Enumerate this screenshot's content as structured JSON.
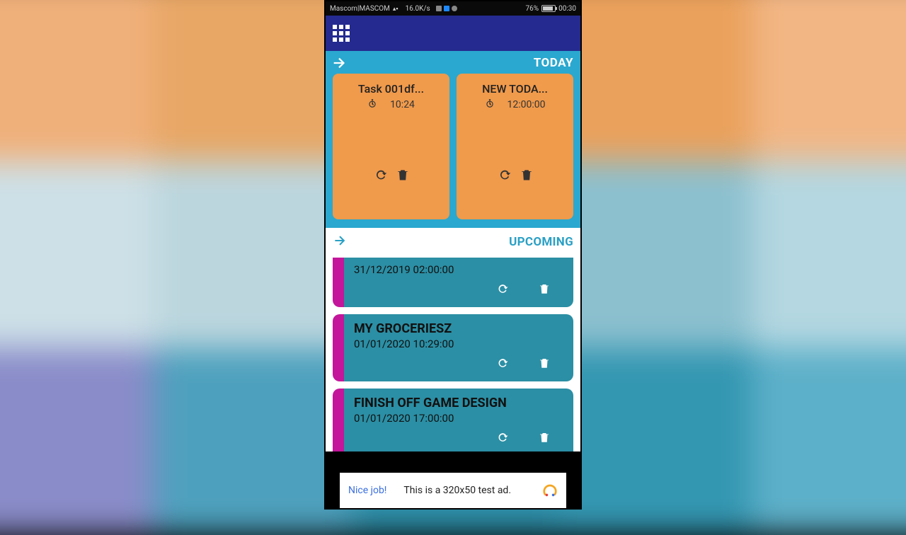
{
  "status": {
    "carrier": "Mascom|MASCOM",
    "speed": "16.0K/s",
    "battery_pct": "76%",
    "time": "00:30"
  },
  "sections": {
    "today_label": "TODAY",
    "upcoming_label": "UPCOMING"
  },
  "today_cards": [
    {
      "title": "Task 001df...",
      "time": "10:24"
    },
    {
      "title": "NEW TODA...",
      "time": "12:00:00"
    }
  ],
  "upcoming": [
    {
      "title": "",
      "datetime": "31/12/2019 02:00:00"
    },
    {
      "title": "MY GROCERIESZ",
      "datetime": "01/01/2020 10:29:00"
    },
    {
      "title": "FINISH OFF GAME DESIGN",
      "datetime": "01/01/2020 17:00:00"
    }
  ],
  "ad": {
    "nice": "Nice job!",
    "text": "This is a 320x50 test ad."
  }
}
